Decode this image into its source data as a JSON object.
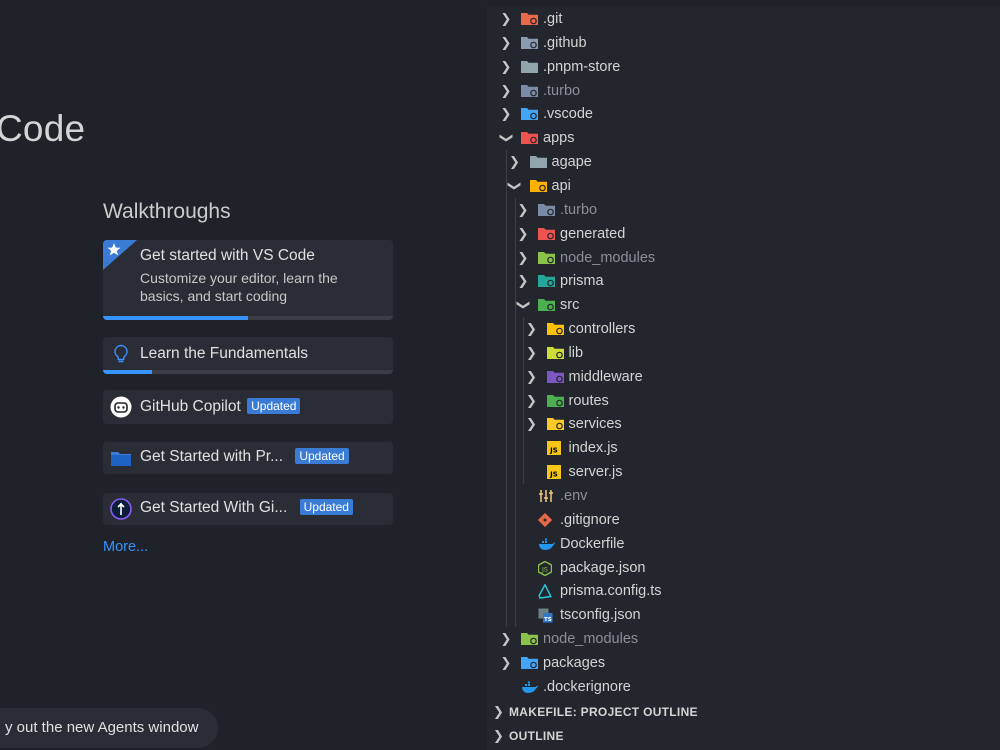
{
  "welcome": {
    "title": "Code",
    "walkthroughs_heading": "Walkthroughs",
    "cards": [
      {
        "title": "Get started with VS Code",
        "description": "Customize your editor, learn the basics, and start coding",
        "progress": 0.5
      },
      {
        "title": "Learn the Fundamentals",
        "progress": 0.17
      },
      {
        "title": "GitHub Copilot",
        "badge": "Updated"
      },
      {
        "title": "Get Started with Pr...",
        "badge": "Updated"
      },
      {
        "title": "Get Started With Gi...",
        "badge": "Updated"
      }
    ],
    "more_link": "More...",
    "agents_button": "y out the new Agents window"
  },
  "explorer": {
    "tree": [
      {
        "label": ".git",
        "depth": 0,
        "kind": "folder",
        "open": false,
        "dim": false,
        "icon": "git-folder-icon",
        "color": "#e8684a"
      },
      {
        "label": ".github",
        "depth": 0,
        "kind": "folder",
        "open": false,
        "dim": false,
        "icon": "github-folder-icon",
        "color": "#8a9bb0"
      },
      {
        "label": ".pnpm-store",
        "depth": 0,
        "kind": "folder",
        "open": false,
        "dim": false,
        "icon": "folder-icon",
        "color": "#90a4ae"
      },
      {
        "label": ".turbo",
        "depth": 0,
        "kind": "folder",
        "open": false,
        "dim": true,
        "icon": "turbo-folder-icon",
        "color": "#7a8ba5"
      },
      {
        "label": ".vscode",
        "depth": 0,
        "kind": "folder",
        "open": false,
        "dim": false,
        "icon": "vscode-folder-icon",
        "color": "#42a5f5"
      },
      {
        "label": "apps",
        "depth": 0,
        "kind": "folder",
        "open": true,
        "dim": false,
        "icon": "apps-folder-icon",
        "color": "#ef5350"
      },
      {
        "label": "agape",
        "depth": 1,
        "kind": "folder",
        "open": false,
        "dim": false,
        "icon": "folder-icon",
        "color": "#90a4ae"
      },
      {
        "label": "api",
        "depth": 1,
        "kind": "folder",
        "open": true,
        "dim": false,
        "icon": "api-folder-icon",
        "color": "#ffb300"
      },
      {
        "label": ".turbo",
        "depth": 2,
        "kind": "folder",
        "open": false,
        "dim": true,
        "icon": "turbo-folder-icon",
        "color": "#7a8ba5"
      },
      {
        "label": "generated",
        "depth": 2,
        "kind": "folder",
        "open": false,
        "dim": false,
        "icon": "generated-folder-icon",
        "color": "#ef5350"
      },
      {
        "label": "node_modules",
        "depth": 2,
        "kind": "folder",
        "open": false,
        "dim": true,
        "icon": "node-modules-folder-icon",
        "color": "#8bc34a"
      },
      {
        "label": "prisma",
        "depth": 2,
        "kind": "folder",
        "open": false,
        "dim": false,
        "icon": "prisma-folder-icon",
        "color": "#26a69a"
      },
      {
        "label": "src",
        "depth": 2,
        "kind": "folder",
        "open": true,
        "dim": false,
        "icon": "src-folder-icon",
        "color": "#4caf50"
      },
      {
        "label": "controllers",
        "depth": 3,
        "kind": "folder",
        "open": false,
        "dim": false,
        "icon": "controllers-folder-icon",
        "color": "#ffc107"
      },
      {
        "label": "lib",
        "depth": 3,
        "kind": "folder",
        "open": false,
        "dim": false,
        "icon": "lib-folder-icon",
        "color": "#cddc39"
      },
      {
        "label": "middleware",
        "depth": 3,
        "kind": "folder",
        "open": false,
        "dim": false,
        "icon": "middleware-folder-icon",
        "color": "#7e57c2"
      },
      {
        "label": "routes",
        "depth": 3,
        "kind": "folder",
        "open": false,
        "dim": false,
        "icon": "routes-folder-icon",
        "color": "#4caf50"
      },
      {
        "label": "services",
        "depth": 3,
        "kind": "folder",
        "open": false,
        "dim": false,
        "icon": "services-folder-icon",
        "color": "#ffca28"
      },
      {
        "label": "index.js",
        "depth": 3,
        "kind": "file",
        "dim": false,
        "icon": "javascript-file-icon",
        "color": "#f5c518"
      },
      {
        "label": "server.js",
        "depth": 3,
        "kind": "file",
        "dim": false,
        "icon": "javascript-file-icon",
        "color": "#f5c518"
      },
      {
        "label": ".env",
        "depth": 2,
        "kind": "file",
        "dim": true,
        "icon": "env-file-icon",
        "color": "#e6c07b"
      },
      {
        "label": ".gitignore",
        "depth": 2,
        "kind": "file",
        "dim": false,
        "icon": "git-file-icon",
        "color": "#e8684a"
      },
      {
        "label": "Dockerfile",
        "depth": 2,
        "kind": "file",
        "dim": false,
        "icon": "docker-file-icon",
        "color": "#2496ed"
      },
      {
        "label": "package.json",
        "depth": 2,
        "kind": "file",
        "dim": false,
        "icon": "nodejs-file-icon",
        "color": "#8bc34a"
      },
      {
        "label": "prisma.config.ts",
        "depth": 2,
        "kind": "file",
        "dim": false,
        "icon": "prisma-file-icon",
        "color": "#26c6da"
      },
      {
        "label": "tsconfig.json",
        "depth": 2,
        "kind": "file",
        "dim": false,
        "icon": "tsconfig-file-icon",
        "color": "#3178c6"
      },
      {
        "label": "node_modules",
        "depth": 0,
        "kind": "folder",
        "open": false,
        "dim": true,
        "icon": "node-modules-folder-icon",
        "color": "#8bc34a"
      },
      {
        "label": "packages",
        "depth": 0,
        "kind": "folder",
        "open": false,
        "dim": false,
        "icon": "packages-folder-icon",
        "color": "#42a5f5"
      },
      {
        "label": ".dockerignore",
        "depth": 0,
        "kind": "file",
        "dim": false,
        "icon": "docker-file-icon",
        "color": "#2496ed"
      }
    ],
    "sections": [
      {
        "label": "MAKEFILE: PROJECT OUTLINE"
      },
      {
        "label": "OUTLINE"
      }
    ]
  }
}
